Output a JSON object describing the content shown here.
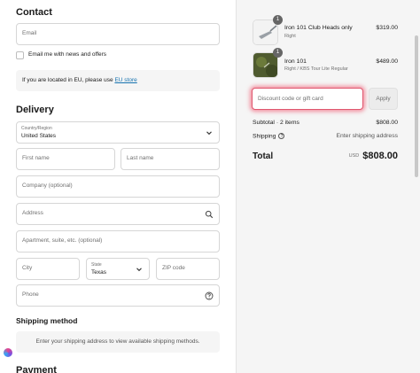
{
  "contact": {
    "heading": "Contact",
    "email_placeholder": "Email",
    "newsletter_label": "Email me with news and offers",
    "eu_text": "If you are located in EU, please use ",
    "eu_link": "EU store"
  },
  "delivery": {
    "heading": "Delivery",
    "country_label": "Country/Region",
    "country_value": "United States",
    "first_name": "First name",
    "last_name": "Last name",
    "company": "Company (optional)",
    "address": "Address",
    "apartment": "Apartment, suite, etc. (optional)",
    "city": "City",
    "state_label": "State",
    "state_value": "Texas",
    "zip": "ZIP code",
    "phone": "Phone"
  },
  "shipping": {
    "heading": "Shipping method",
    "message": "Enter your shipping address to view available shipping methods."
  },
  "payment": {
    "heading": "Payment"
  },
  "summary": {
    "items": [
      {
        "qty": "1",
        "name": "Iron 101 Club Heads only",
        "variant": "Right",
        "price": "$319.00"
      },
      {
        "qty": "1",
        "name": "Iron 101",
        "variant": "Right / KBS Tour Lite Regular",
        "price": "$489.00"
      }
    ],
    "discount_placeholder": "Discount code or gift card",
    "apply_label": "Apply",
    "subtotal_label": "Subtotal · 2 items",
    "subtotal_value": "$808.00",
    "shipping_label": "Shipping",
    "shipping_value": "Enter shipping address",
    "total_label": "Total",
    "currency": "USD",
    "total_value": "$808.00"
  }
}
